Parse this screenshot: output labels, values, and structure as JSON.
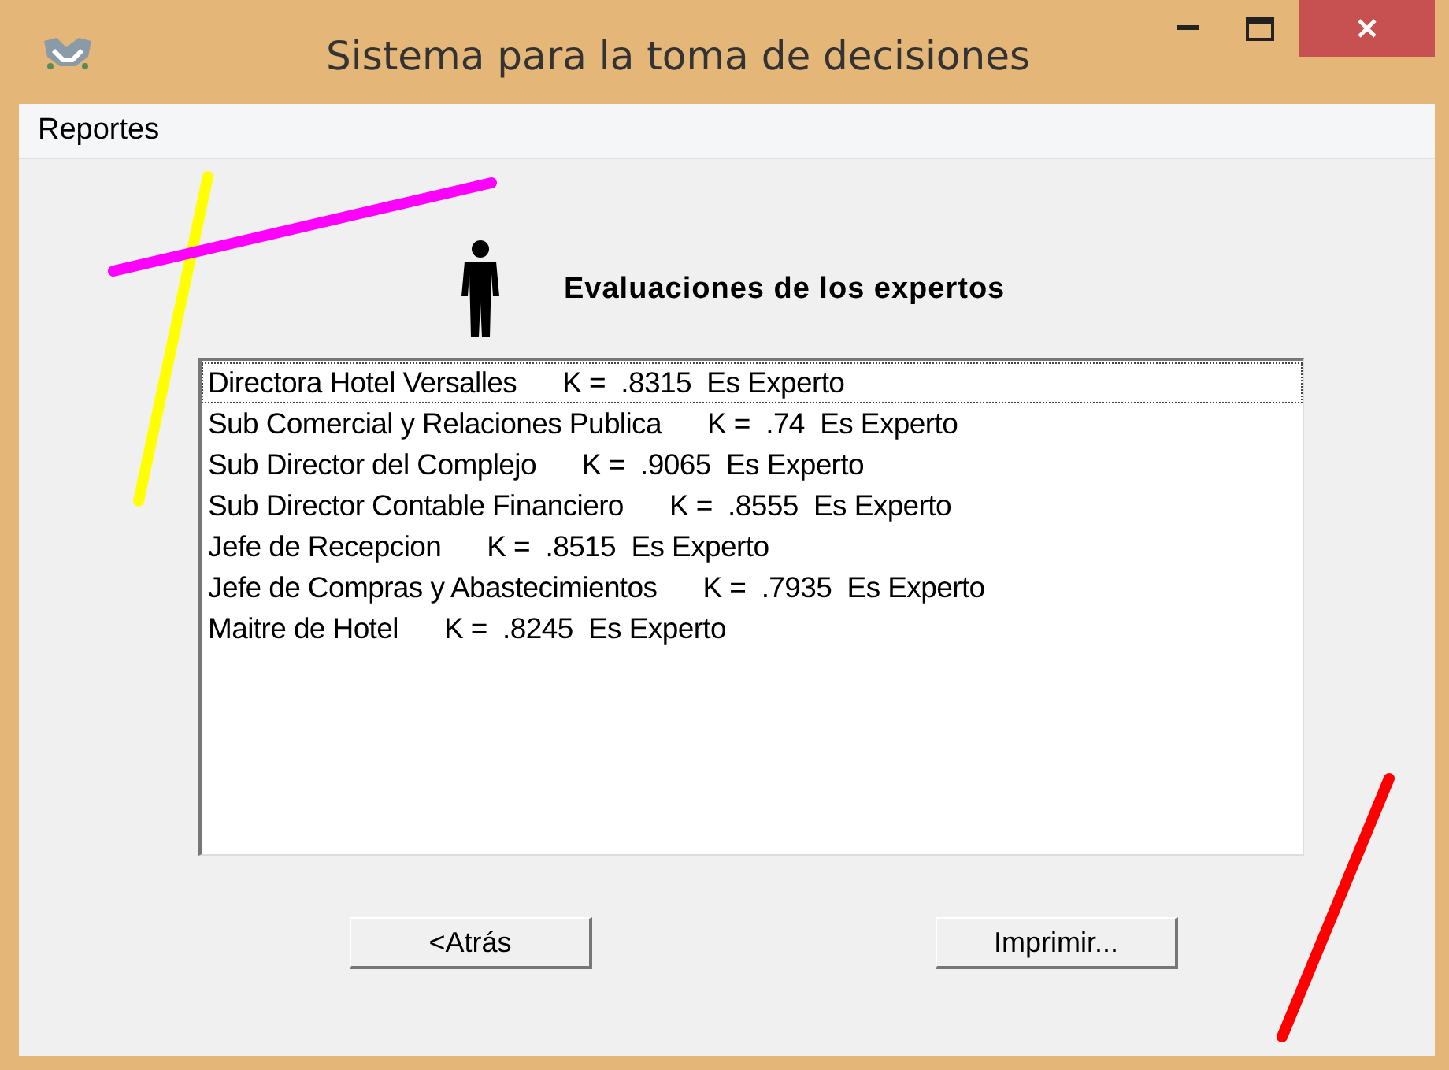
{
  "window": {
    "title": "Sistema para la toma de decisiones"
  },
  "menu": [
    {
      "label": "Reportes"
    }
  ],
  "heading": "Evaluaciones de los expertos",
  "list": [
    {
      "text": "Directora Hotel Versalles      K =  .8315  Es Experto",
      "selected": true
    },
    {
      "text": "Sub Comercial y Relaciones Publica      K =  .74  Es Experto",
      "selected": false
    },
    {
      "text": "Sub Director del Complejo      K =  .9065  Es Experto",
      "selected": false
    },
    {
      "text": "Sub Director Contable Financiero      K =  .8555  Es Experto",
      "selected": false
    },
    {
      "text": "Jefe de Recepcion      K =  .8515  Es Experto",
      "selected": false
    },
    {
      "text": "Jefe de Compras y Abastecimientos      K =  .7935  Es Experto",
      "selected": false
    },
    {
      "text": "Maitre de Hotel      K =  .8245  Es Experto",
      "selected": false
    }
  ],
  "buttons": [
    {
      "label": "<Atrás"
    },
    {
      "label": "Imprimir..."
    }
  ]
}
